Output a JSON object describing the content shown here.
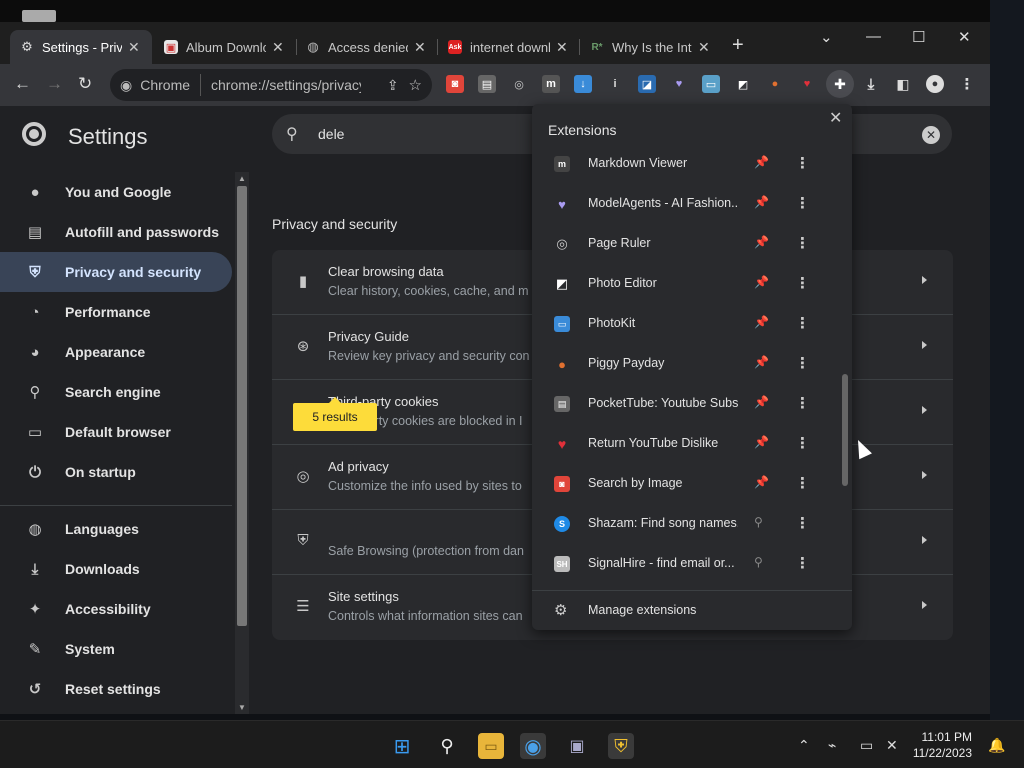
{
  "tabs": [
    {
      "title": "Settings - Privacy",
      "favicon": "gear-icon",
      "active": true
    },
    {
      "title": "Album Downloader",
      "favicon": "album-icon",
      "active": false
    },
    {
      "title": "Access denied",
      "favicon": "globe-icon",
      "active": false
    },
    {
      "title": "internet download",
      "favicon": "ask-icon",
      "favicon_text": "Ask",
      "active": false
    },
    {
      "title": "Why Is the Internet",
      "favicon": "r-icon",
      "favicon_text": "R*",
      "active": false
    }
  ],
  "toolbar": {
    "chip_label": "Chrome",
    "url": "chrome://settings/privacy"
  },
  "settings": {
    "title": "Settings",
    "search_value": "dele"
  },
  "sidebar": {
    "items": [
      {
        "label": "You and Google",
        "icon": "person-icon"
      },
      {
        "label": "Autofill and passwords",
        "icon": "clipboard-icon"
      },
      {
        "label": "Privacy and security",
        "icon": "shield-icon",
        "active": true
      },
      {
        "label": "Performance",
        "icon": "gauge-icon"
      },
      {
        "label": "Appearance",
        "icon": "palette-icon"
      },
      {
        "label": "Search engine",
        "icon": "search-icon"
      },
      {
        "label": "Default browser",
        "icon": "browser-icon"
      },
      {
        "label": "On startup",
        "icon": "power-icon"
      },
      {
        "label": "Languages",
        "icon": "globe-icon"
      },
      {
        "label": "Downloads",
        "icon": "download-icon"
      },
      {
        "label": "Accessibility",
        "icon": "accessibility-icon"
      },
      {
        "label": "System",
        "icon": "wrench-icon"
      },
      {
        "label": "Reset settings",
        "icon": "reset-icon"
      }
    ]
  },
  "privacy": {
    "section_title": "Privacy and security",
    "results_badge": "5 results",
    "rows": [
      {
        "title": "Clear browsing data",
        "desc": "Clear history, cookies, cache, and m",
        "icon": "trash-icon"
      },
      {
        "title": "Privacy Guide",
        "desc": "Review key privacy and security con",
        "icon": "compass-icon"
      },
      {
        "title": "Third-party cookies",
        "desc": "Third-party cookies are blocked in I",
        "icon": "cookie-icon"
      },
      {
        "title": "Ad privacy",
        "desc": "Customize the info used by sites to",
        "icon": "ad-privacy-icon"
      },
      {
        "title": "",
        "desc": "Safe Browsing (protection from dan",
        "icon": "shield-icon"
      },
      {
        "title": "Site settings",
        "desc": "Controls what information sites can",
        "icon": "sliders-icon"
      }
    ]
  },
  "extensions": {
    "header": "Extensions",
    "manage_label": "Manage extensions",
    "items": [
      {
        "name": "Markdown Viewer",
        "pinned": true,
        "icon": "markdown-icon",
        "color": "#444"
      },
      {
        "name": "ModelAgents - AI Fashion...",
        "pinned": true,
        "icon": "heart-icon",
        "color": "#8a7fd8"
      },
      {
        "name": "Page Ruler",
        "pinned": true,
        "icon": "ruler-icon",
        "color": "#555"
      },
      {
        "name": "Photo Editor",
        "pinned": true,
        "icon": "photo-editor-icon",
        "color": "#222"
      },
      {
        "name": "PhotoKit",
        "pinned": true,
        "icon": "photokit-icon",
        "color": "#3a8bd8"
      },
      {
        "name": "Piggy Payday",
        "pinned": true,
        "icon": "piggy-icon",
        "color": "#6b3b2a"
      },
      {
        "name": "PocketTube: Youtube Subs...",
        "pinned": true,
        "icon": "folder-icon",
        "color": "#666"
      },
      {
        "name": "Return YouTube Dislike",
        "pinned": true,
        "icon": "dislike-icon",
        "color": "#d3303a"
      },
      {
        "name": "Search by Image",
        "pinned": true,
        "icon": "camera-icon",
        "color": "#e0453a"
      },
      {
        "name": "Shazam: Find song names...",
        "pinned": false,
        "icon": "shazam-icon",
        "color": "#1f8ae6"
      },
      {
        "name": "SignalHire - find email or...",
        "pinned": false,
        "icon": "signalhire-icon",
        "icon_text": "SH",
        "color": "#999"
      }
    ]
  },
  "clock": {
    "time": "11:01 PM",
    "date": "11/22/2023"
  }
}
